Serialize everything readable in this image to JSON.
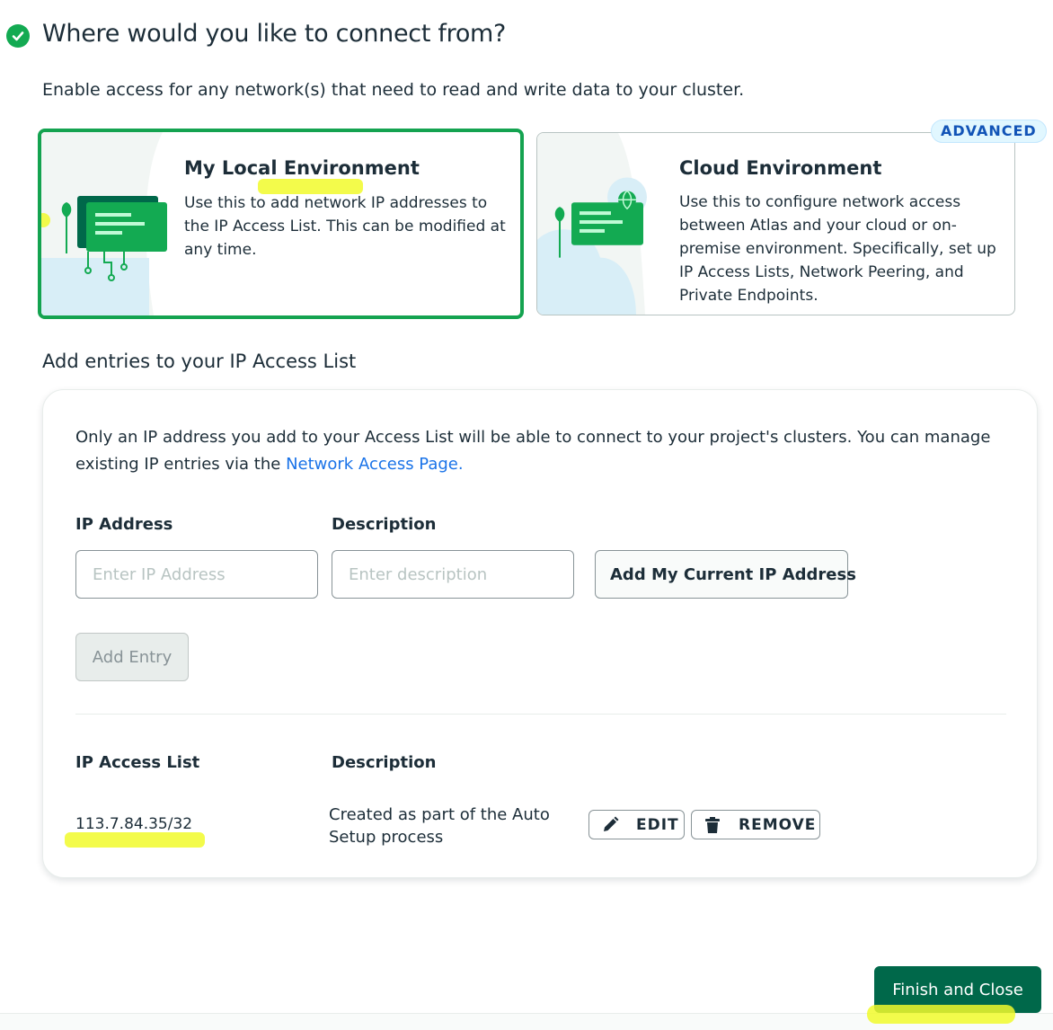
{
  "header": {
    "title": "Where would you like to connect from?",
    "subtitle": "Enable access for any network(s) that need to read and write data to your cluster."
  },
  "environments": {
    "local": {
      "title": "My Local Environment",
      "description": "Use this to add network IP addresses to the IP Access List. This can be modified at any time.",
      "selected": true
    },
    "cloud": {
      "title": "Cloud Environment",
      "description": "Use this to configure network access between Atlas and your cloud or on-premise environment. Specifically, set up IP Access Lists, Network Peering, and Private Endpoints.",
      "badge": "ADVANCED"
    }
  },
  "access_list_section": {
    "title": "Add entries to your IP Access List",
    "info_text": "Only an IP address you add to your Access List will be able to connect to your project's clusters. You can manage existing IP entries via the ",
    "info_link": "Network Access Page.",
    "ip_label": "IP Address",
    "ip_placeholder": "Enter IP Address",
    "desc_label": "Description",
    "desc_placeholder": "Enter description",
    "add_current_ip_button": "Add My Current IP Address",
    "add_entry_button": "Add Entry",
    "list_header": "IP Access List",
    "list_desc_header": "Description",
    "entries": [
      {
        "ip": "113.7.84.35/32",
        "description": "Created as part of the Auto Setup process",
        "edit_label": "EDIT",
        "remove_label": "REMOVE"
      }
    ]
  },
  "footer": {
    "finish_button": "Finish and Close"
  },
  "colors": {
    "accent_green": "#13aa52",
    "primary_button": "#00684a",
    "link_blue": "#1a73e8",
    "highlighter": "#f1fa2c"
  }
}
